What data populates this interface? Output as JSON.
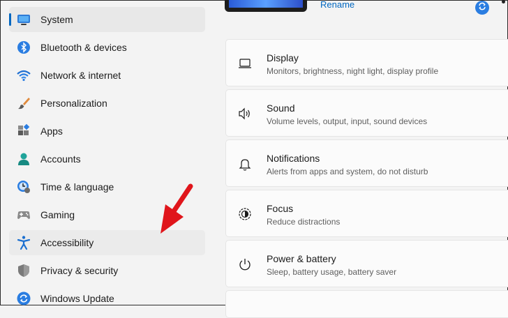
{
  "sidebar": {
    "items": [
      {
        "label": "System",
        "icon": "monitor-icon"
      },
      {
        "label": "Bluetooth & devices",
        "icon": "bluetooth-icon"
      },
      {
        "label": "Network & internet",
        "icon": "wifi-icon"
      },
      {
        "label": "Personalization",
        "icon": "brush-icon"
      },
      {
        "label": "Apps",
        "icon": "apps-icon"
      },
      {
        "label": "Accounts",
        "icon": "person-icon"
      },
      {
        "label": "Time & language",
        "icon": "clock-globe-icon"
      },
      {
        "label": "Gaming",
        "icon": "gamepad-icon"
      },
      {
        "label": "Accessibility",
        "icon": "accessibility-icon"
      },
      {
        "label": "Privacy & security",
        "icon": "shield-icon"
      },
      {
        "label": "Windows Update",
        "icon": "update-icon"
      }
    ],
    "selected": "System",
    "hovered": "Accessibility"
  },
  "header": {
    "rename_link": "Rename"
  },
  "main": {
    "cards": [
      {
        "title": "Display",
        "subtitle": "Monitors, brightness, night light, display profile",
        "icon": "laptop-icon"
      },
      {
        "title": "Sound",
        "subtitle": "Volume levels, output, input, sound devices",
        "icon": "speaker-icon"
      },
      {
        "title": "Notifications",
        "subtitle": "Alerts from apps and system, do not disturb",
        "icon": "bell-icon"
      },
      {
        "title": "Focus",
        "subtitle": "Reduce distractions",
        "icon": "focus-icon"
      },
      {
        "title": "Power & battery",
        "subtitle": "Sleep, battery usage, battery saver",
        "icon": "power-icon"
      }
    ]
  },
  "colors": {
    "accent": "#0067c0",
    "annotation_arrow": "#e0151b"
  }
}
